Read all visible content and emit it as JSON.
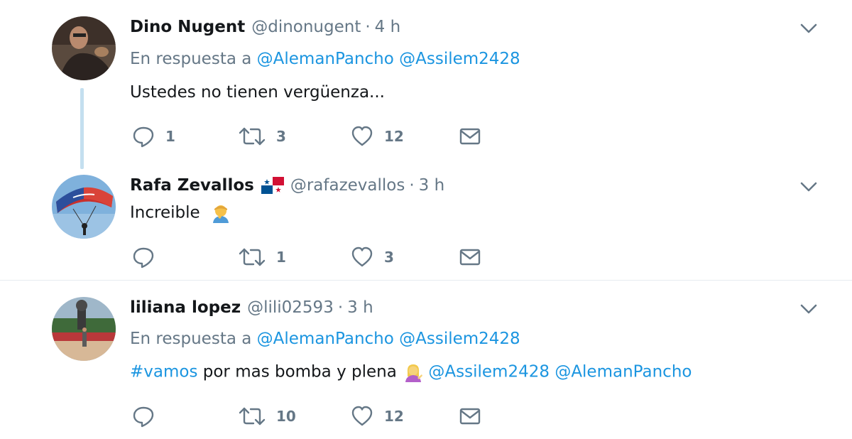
{
  "tweets": [
    {
      "fullname": "Dino Nugent",
      "handle": "@dinonugent",
      "dot": "·",
      "time": "4 h",
      "replying_prefix": "En respuesta a",
      "replying_to": [
        "@AlemanPancho",
        "@Assilem2428"
      ],
      "text": "Ustedes no tienen vergüenza...",
      "actions": {
        "replies": "1",
        "retweets": "3",
        "likes": "12"
      }
    },
    {
      "fullname": "Rafa Zevallos",
      "handle": "@rafazevallos",
      "dot": "·",
      "time": "3 h",
      "flag_icon": "panama-flag-icon",
      "text": "Increible",
      "emoji": "person-facepalming-emoji",
      "actions": {
        "replies": "",
        "retweets": "1",
        "likes": "3"
      }
    },
    {
      "fullname": "liliana lopez",
      "handle": "@lili02593",
      "dot": "·",
      "time": "3 h",
      "replying_prefix": "En respuesta a",
      "replying_to": [
        "@AlemanPancho",
        "@Assilem2428"
      ],
      "hashtag": "#vamos",
      "text_middle": "por mas bomba y plena",
      "emoji": "woman-tipping-hand-emoji",
      "mentions": [
        "@Assilem2428",
        "@AlemanPancho"
      ],
      "actions": {
        "replies": "",
        "retweets": "10",
        "likes": "12"
      }
    }
  ],
  "colors": {
    "text": "#14171a",
    "secondary": "#657786",
    "link": "#1b95e0",
    "thread_line": "#c4dfef",
    "separator": "#e6ecf0"
  }
}
